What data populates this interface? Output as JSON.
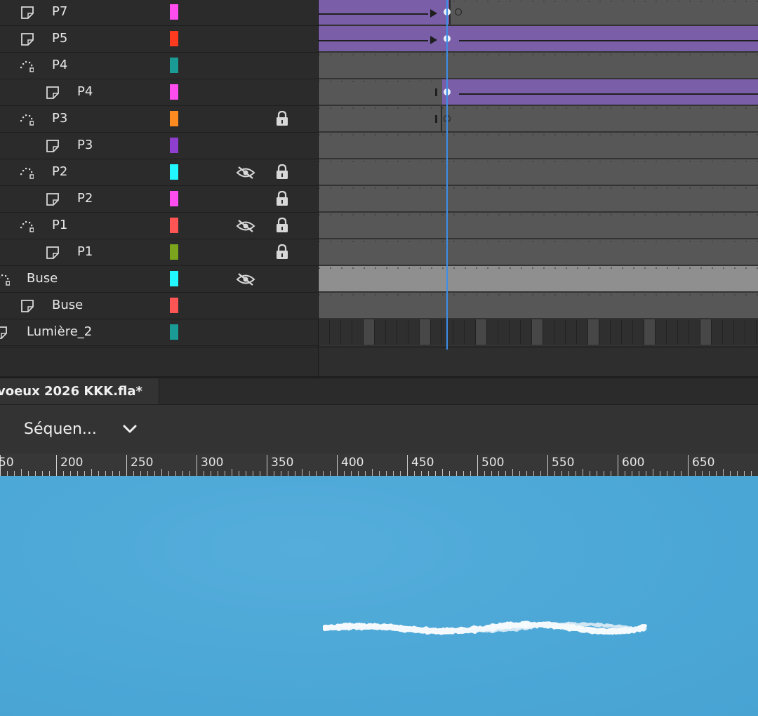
{
  "timeline": {
    "layers": [
      {
        "name": "P7",
        "type": "layer",
        "color": "#ff4df0",
        "hidden": false,
        "locked": false
      },
      {
        "name": "P5",
        "type": "layer",
        "color": "#ff3b1f",
        "hidden": false,
        "locked": false
      },
      {
        "name": "P4",
        "type": "guide",
        "color": "#1a9b95",
        "hidden": false,
        "locked": false
      },
      {
        "name": "P4",
        "type": "guided",
        "color": "#ff4df0",
        "hidden": false,
        "locked": false
      },
      {
        "name": "P3",
        "type": "guide",
        "color": "#ff8a1f",
        "hidden": false,
        "locked": true
      },
      {
        "name": "P3",
        "type": "guided",
        "color": "#8e3fd0",
        "hidden": false,
        "locked": false
      },
      {
        "name": "P2",
        "type": "guide",
        "color": "#22f6ff",
        "hidden": true,
        "locked": true
      },
      {
        "name": "P2",
        "type": "guided",
        "color": "#ff4df0",
        "hidden": false,
        "locked": true
      },
      {
        "name": "P1",
        "type": "guide",
        "color": "#ff5555",
        "hidden": true,
        "locked": true
      },
      {
        "name": "P1",
        "type": "guided",
        "color": "#7aa51d",
        "hidden": false,
        "locked": true
      },
      {
        "name": "Buse",
        "type": "guide-root",
        "color": "#22f6ff",
        "hidden": true,
        "locked": false
      },
      {
        "name": "Buse",
        "type": "layer",
        "color": "#ff5555",
        "hidden": false,
        "locked": false
      },
      {
        "name": "Lumière_2",
        "type": "layer-root",
        "color": "#1a9b95",
        "hidden": false,
        "locked": false
      }
    ],
    "selected_layer_index": 10
  },
  "document": {
    "tab_title": "voeux 2026 KKK.fla*"
  },
  "scene": {
    "label": "Séquen...",
    "chevron_icon": "chevron-down-icon"
  },
  "ruler": {
    "labels": [
      "50",
      "200",
      "250",
      "300",
      "350",
      "400",
      "450",
      "500",
      "550",
      "600",
      "650"
    ]
  },
  "colors": {
    "tween": "#7b5ea8",
    "playhead": "#3d8ee6",
    "stage": "#4ba7d6"
  }
}
